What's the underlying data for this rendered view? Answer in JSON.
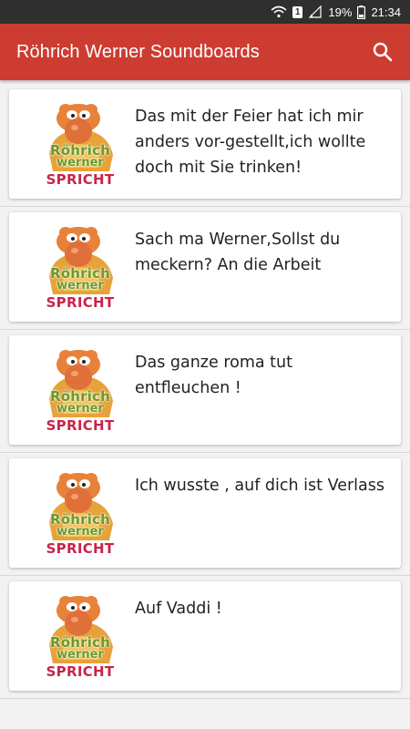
{
  "status_bar": {
    "battery_percent": "19%",
    "time": "21:34",
    "sim_badge": "1"
  },
  "app_bar": {
    "title": "Röhrich Werner Soundboards",
    "search_icon": "search-icon"
  },
  "logo": {
    "line1": "Röhrich",
    "line2": "werner",
    "line3": "SPRICHT"
  },
  "sounds": [
    {
      "text": "Das mit der Feier hat ich mir anders vor-gestellt,ich wollte doch mit Sie trinken!"
    },
    {
      "text": "Sach ma Werner,Sollst du meckern? An die Arbeit"
    },
    {
      "text": "Das ganze roma tut entfleuchen !"
    },
    {
      "text": "Ich wusste , auf dich ist Verlass"
    },
    {
      "text": "Auf Vaddi !"
    }
  ],
  "colors": {
    "app_bar": "#cd3c30",
    "status_bar": "#2f2f2f",
    "logo_green": "#6a9a2a",
    "logo_red": "#c8244a",
    "logo_orange": "#e8823a"
  }
}
